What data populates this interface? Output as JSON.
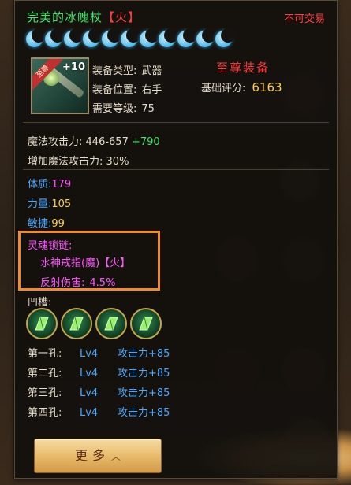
{
  "item": {
    "name": "完美的冰魄杖",
    "element": "【火】",
    "trade_status": "不可交易",
    "enhance": "+10",
    "corner_label": "至尊",
    "moons": 11
  },
  "meta": {
    "type_label": "装备类型:",
    "type_value": "武器",
    "slot_label": "装备位置:",
    "slot_value": "右手",
    "level_label": "需要等级:",
    "level_value": "75",
    "rank": "至尊装备",
    "score_label": "基础评分:",
    "score_value": "6163"
  },
  "attack": {
    "label": "魔法攻击力:",
    "range": "446-657",
    "bonus": "+790",
    "extra_label": "增加魔法攻击力:",
    "extra_value": "30%"
  },
  "stats": [
    {
      "name": "体质:",
      "value": "179"
    },
    {
      "name": "力量:",
      "value": "105"
    },
    {
      "name": "敏捷:",
      "value": "99"
    }
  ],
  "soul_chain": {
    "title": "灵魂锁链:",
    "ring": "水神戒指(魔)",
    "ring_element": "【火】",
    "reflect_label": "反射伤害:",
    "reflect_value": "4.5%"
  },
  "sockets": {
    "label": "凹槽:",
    "holes": [
      {
        "name": "第一孔:",
        "level": "Lv4",
        "effect": "攻击力+85"
      },
      {
        "name": "第二孔:",
        "level": "Lv4",
        "effect": "攻击力+85"
      },
      {
        "name": "第三孔:",
        "level": "Lv4",
        "effect": "攻击力+85"
      },
      {
        "name": "第四孔:",
        "level": "Lv4",
        "effect": "攻击力+85"
      }
    ]
  },
  "more_button": "更多"
}
